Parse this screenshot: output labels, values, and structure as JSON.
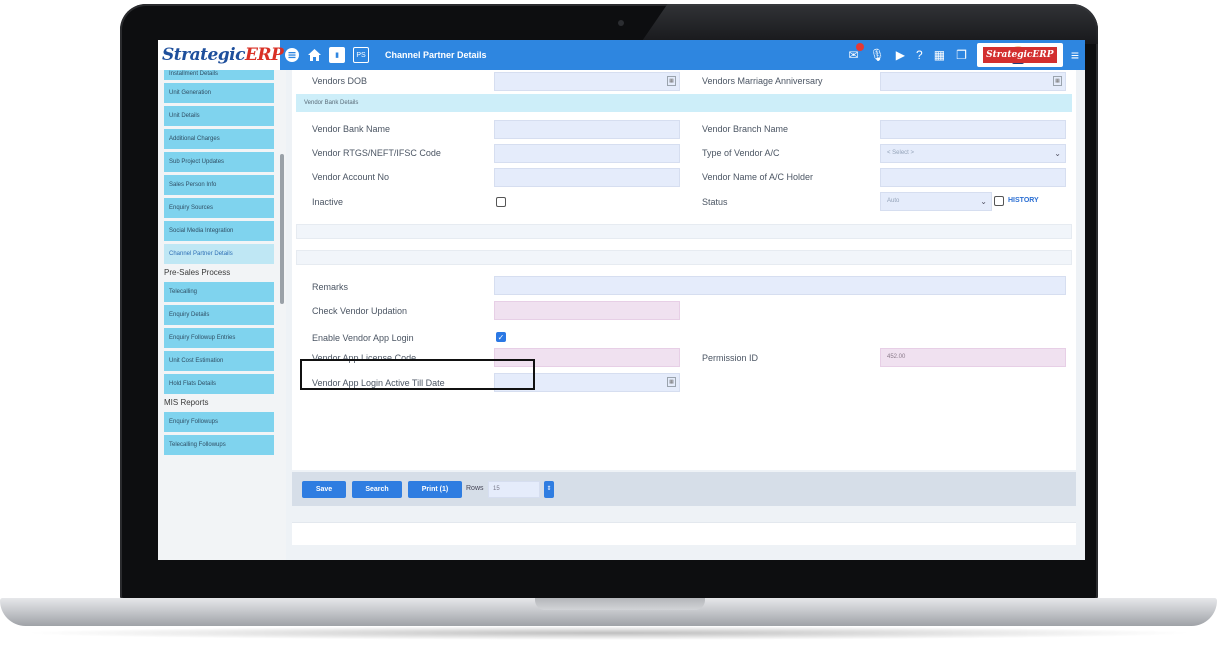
{
  "app": {
    "brand_left": "Strategic",
    "brand_right": "ERP",
    "page_title": "Channel Partner Details",
    "header_icons": [
      "menu-circle-icon",
      "home-icon",
      "bookmark-icon",
      "ps-icon"
    ],
    "ps_label": "PS",
    "right_logo_text": "StrategicERP"
  },
  "sidebar": {
    "group1": [
      {
        "label": "Installment Details"
      },
      {
        "label": "Unit Generation"
      },
      {
        "label": "Unit Details"
      },
      {
        "label": "Additional Charges"
      },
      {
        "label": "Sub Project Updates"
      },
      {
        "label": "Sales Person Info"
      },
      {
        "label": "Enquiry Sources"
      },
      {
        "label": "Social Media Integration"
      },
      {
        "label": "Channel Partner Details",
        "active": true
      }
    ],
    "head2": "Pre-Sales Process",
    "group2": [
      {
        "label": "Telecalling"
      },
      {
        "label": "Enquiry Details"
      },
      {
        "label": "Enquiry Followup Entries"
      },
      {
        "label": "Unit Cost Estimation"
      },
      {
        "label": "Hold Flats Details"
      }
    ],
    "head3": "MIS Reports",
    "group3": [
      {
        "label": "Enquiry Followups"
      },
      {
        "label": "Telecalling Followups"
      }
    ]
  },
  "form": {
    "vendors_dob": "Vendors DOB",
    "vendors_marriage": "Vendors Marriage Anniversary",
    "bank_section": "Vendor Bank Details",
    "bank_name": "Vendor Bank Name",
    "branch_name": "Vendor Branch Name",
    "ifsc": "Vendor RTGS/NEFT/IFSC Code",
    "ac_type": "Type of Vendor A/C",
    "ac_type_value": "< Select >",
    "account_no": "Vendor Account No",
    "ac_holder": "Vendor Name of A/C Holder",
    "inactive": "Inactive",
    "status": "Status",
    "status_value": "Auto",
    "history": "HISTORY",
    "remarks": "Remarks",
    "check_updation": "Check Vendor Updation",
    "enable_app_login": "Enable Vendor App Login",
    "enable_app_login_checked": true,
    "license_code": "Vendor App License Code",
    "permission_id": "Permission ID",
    "permission_value": "452.00",
    "login_active_till": "Vendor App Login Active Till Date"
  },
  "actions": {
    "save": "Save",
    "search": "Search",
    "print": "Print (1)",
    "rows_label": "Rows",
    "rows_value": "15"
  },
  "colors": {
    "header": "#2e86e0",
    "sidebar_item": "#7fd3ee",
    "field": "#e5ecfb",
    "pink_field": "#f0e1f0",
    "button": "#2f7de1"
  }
}
